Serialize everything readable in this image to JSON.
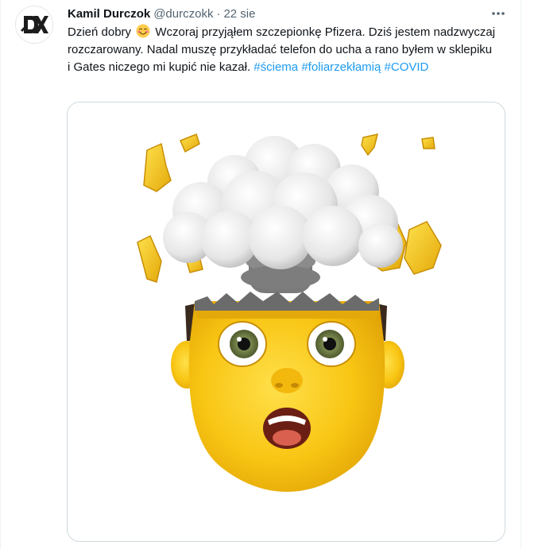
{
  "tweet": {
    "author": {
      "display_name": "Kamil Durczok",
      "handle": "@durczokk",
      "avatar_text": "DX"
    },
    "separator": "·",
    "timestamp": "22 sie",
    "text_parts": {
      "part1": "Dzień dobry",
      "emoji": "smiling-face-emoji",
      "part2": "Wczoraj przyjąłem szczepionkę  Pfizera. Dziś jestem nadzwyczaj rozczarowany. Nadal muszę przykładać telefon do ucha a rano byłem w sklepiku i Gates niczego mi kupić nie kazał.",
      "hashtag1": "#ściema",
      "hashtag2": "#foliarzekłamią",
      "hashtag3": "#COVID"
    },
    "media": {
      "description_icon": "exploding-head-memoji-image"
    },
    "more_icon": "more-horizontal-icon"
  },
  "colors": {
    "text_primary": "#0f1419",
    "text_secondary": "#536471",
    "link": "#1d9bf0",
    "border": "#cfd9de"
  }
}
